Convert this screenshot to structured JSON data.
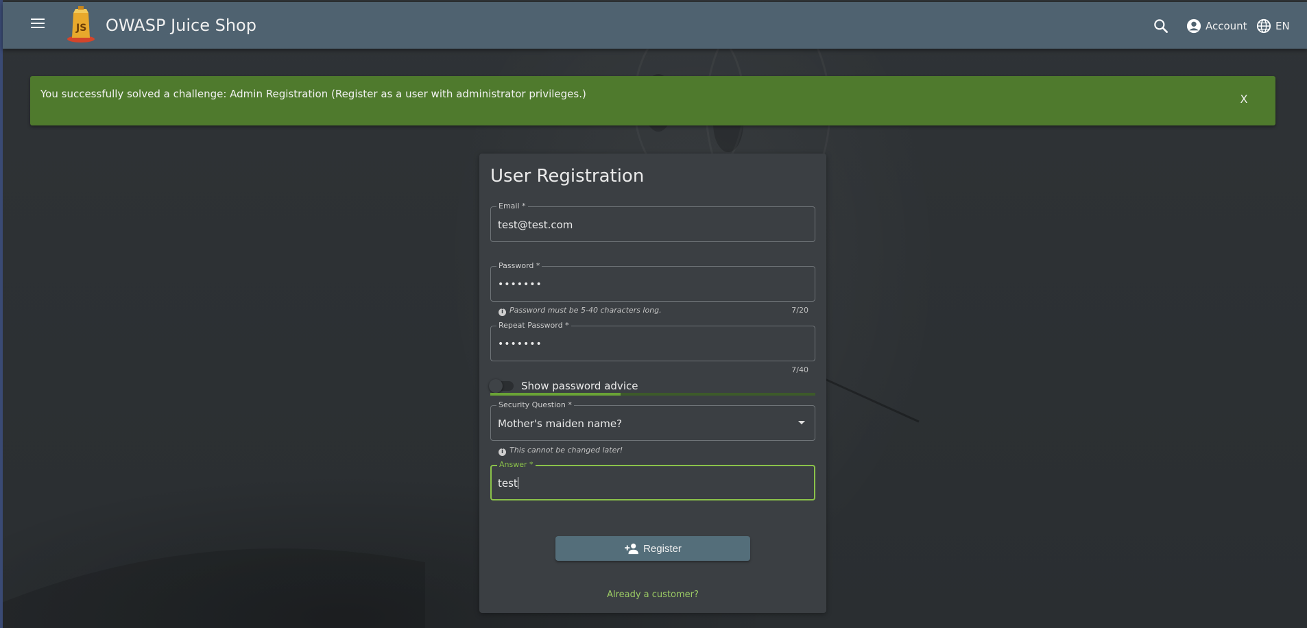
{
  "toolbar": {
    "app_title": "OWASP Juice Shop",
    "account_label": "Account",
    "language_label": "EN",
    "icons": [
      "menu-icon",
      "juice-shop-logo",
      "search-icon",
      "account-circle-icon",
      "language-globe-icon"
    ]
  },
  "snackbar": {
    "message": "You successfully solved a challenge: Admin Registration (Register as a user with administrator privileges.)",
    "close_label": "X",
    "color": "#4f7a2d"
  },
  "form": {
    "title": "User Registration",
    "email": {
      "label": "Email *",
      "value": "test@test.com"
    },
    "password": {
      "label": "Password *",
      "value": "•••••••",
      "hint": "Password must be 5-40 characters long.",
      "counter": "7/20"
    },
    "repeat_password": {
      "label": "Repeat Password *",
      "value": "•••••••",
      "counter": "7/40"
    },
    "password_advice": {
      "label": "Show password advice",
      "enabled": false,
      "strength_fraction": 0.4
    },
    "security_question": {
      "label": "Security Question *",
      "value": "Mother's maiden name?",
      "hint": "This cannot be changed later!"
    },
    "answer": {
      "label": "Answer *",
      "value": "test"
    },
    "register_label": "Register",
    "login_link": "Already a customer?"
  },
  "colors": {
    "toolbar": "#4f6270",
    "accent": "#8bc34a",
    "button": "#546e7a",
    "card": "#3b3f43"
  }
}
